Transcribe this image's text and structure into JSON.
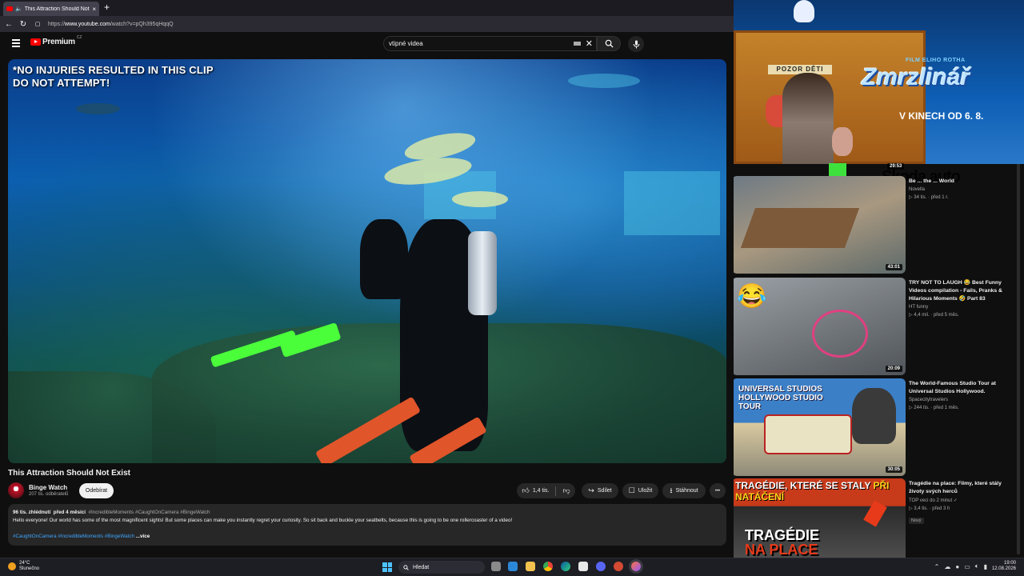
{
  "browser": {
    "tab_title": "This Attraction Should Not Exist",
    "tab_close": "×",
    "new_tab": "+",
    "url_prefix": "https://",
    "url_domain": "www.youtube.com",
    "url_path": "/watch?v=pQh395qHqqQ"
  },
  "header": {
    "logo_text": "Premium",
    "logo_country": "CZ",
    "search_value": "vtipné videa"
  },
  "player": {
    "overlay_line1": "*NO INJURIES RESULTED IN THIS CLIP",
    "overlay_line2": "DO NOT ATTEMPT!"
  },
  "video": {
    "title": "This Attraction Should Not Exist",
    "channel_name": "Binge Watch",
    "channel_subs": "207 tis. odběratelů",
    "subscribe_label": "Odebírat",
    "like_count": "1,4 tis.",
    "share_label": "Sdílet",
    "save_label": "Uložit",
    "download_label": "Stáhnout",
    "more_label": "•••"
  },
  "description": {
    "views": "96 tis. zhlédnutí",
    "age": "před 4 měsíci",
    "tags_line": "#IncredibleMoments #CaughtOnCamera #BingeWatch",
    "text": "Hello everyone! Our world has some of the most magnificent sights! But some places can make you instantly regret your curiosity. So sit back and buckle your seatbelts, because this is going to be one rollercoaster of a video!",
    "hashtags": "#CaughtOnCamera #IncredibleMoments #BingeWatch",
    "more": "...více"
  },
  "ad": {
    "sign": "POZOR DĚTI",
    "film_label": "FILM ELIHO ROTHA",
    "title": "Zmrzlinář",
    "date": "V KINECH OD 6. 8.",
    "brand": "Skoda.auto"
  },
  "recommendations": [
    {
      "duration": "29:53",
      "title": "Ве ... the ... World",
      "channel": "Novella",
      "stats": "▷ 34 tis. · před 1 r.",
      "duration2": "43:01"
    },
    {
      "duration": "20:09",
      "title": "TRY NOT TO LAUGH 😂 Best Funny Videos compilation - Fails, Pranks & Hilarious Moments 🤣 Part 83",
      "channel": "HT funny",
      "stats": "▷ 4,4 mil. · před 5 měs."
    },
    {
      "duration": "30:05",
      "title": "The World-Famous Studio Tour at Universal Studios Hollywood.",
      "channel": "Spacecitytravelers",
      "stats": "▷ 244 tis. · před 1 měs.",
      "thumb_text": "UNIVERSAL STUDIOS HOLLYWOOD STUDIO TOUR"
    },
    {
      "title": "Tragédie na place: Filmy, které stály životy svých herců",
      "channel": "TOP veci do 2 minut ✓",
      "stats": "▷ 3,4 tis. · před 3 h",
      "badge": "Nový",
      "thumb_head_a": "TRAGÉDIE, KTERÉ SE STALY ",
      "thumb_head_b": "PŘI NATÁČENÍ",
      "thumb_bottom_a": "TRAGÉDIE",
      "thumb_bottom_b": "NA PLACE"
    }
  ],
  "taskbar": {
    "temp": "24°C",
    "weather": "Slunečno",
    "search_placeholder": "Hledat",
    "time": "19:00",
    "date": "12.08.2026"
  },
  "colors": {
    "accent_red": "#ff0000",
    "link_blue": "#3ea6ff",
    "bg": "#0f0f0f",
    "pill": "#272727"
  },
  "icons": [
    "menu-icon",
    "search-icon",
    "mic-icon",
    "like-icon",
    "dislike-icon",
    "share-icon",
    "save-icon",
    "download-icon",
    "more-icon",
    "back-icon",
    "reload-icon"
  ]
}
